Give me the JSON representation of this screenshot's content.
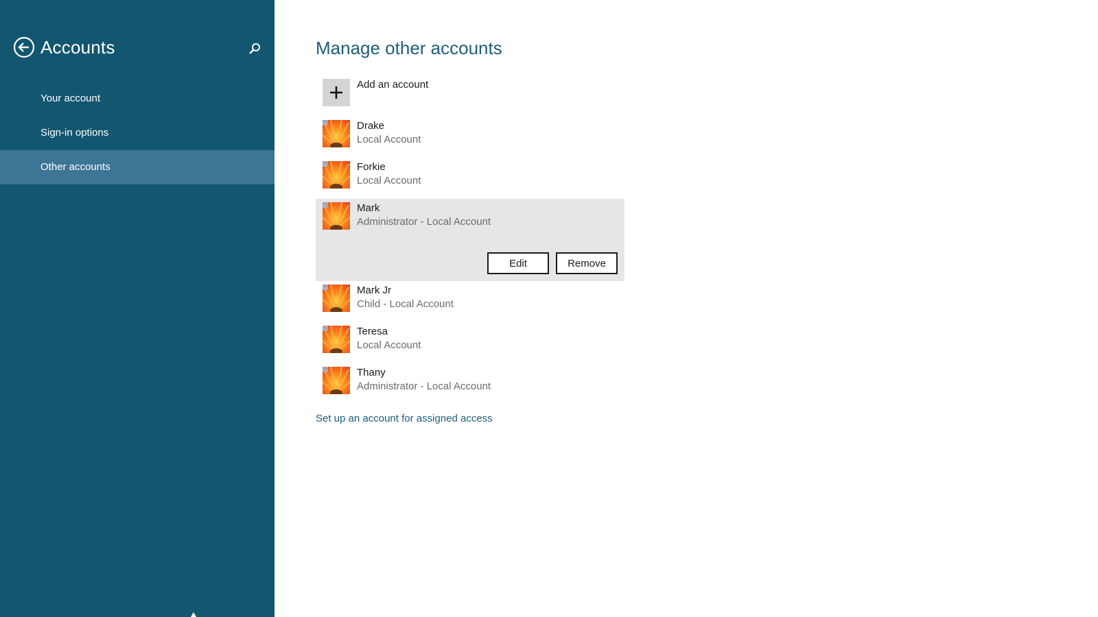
{
  "sidebar": {
    "title": "Accounts",
    "back_icon": "back-arrow-icon",
    "search_icon": "search-icon",
    "items": [
      {
        "label": "Your account",
        "selected": false
      },
      {
        "label": "Sign-in options",
        "selected": false
      },
      {
        "label": "Other accounts",
        "selected": true
      }
    ]
  },
  "main": {
    "title": "Manage other accounts",
    "add_account": {
      "label": "Add an account",
      "icon": "plus-icon"
    },
    "accounts": [
      {
        "name": "Drake",
        "type": "Local Account"
      },
      {
        "name": "Forkie",
        "type": "Local Account"
      },
      {
        "name": "Mark",
        "type": "Administrator - Local Account",
        "selected": true
      },
      {
        "name": "Mark Jr",
        "type": "Child - Local Account"
      },
      {
        "name": "Teresa",
        "type": "Local Account"
      },
      {
        "name": "Thany",
        "type": "Administrator - Local Account"
      }
    ],
    "selected_actions": {
      "edit_label": "Edit",
      "remove_label": "Remove"
    },
    "assigned_access_link": "Set up an account for assigned access"
  },
  "colors": {
    "sidebar_bg": "#135670",
    "sidebar_selected": "#3d7594",
    "accent_text": "#1f5d7a",
    "selected_row_bg": "#e6e6e6"
  }
}
